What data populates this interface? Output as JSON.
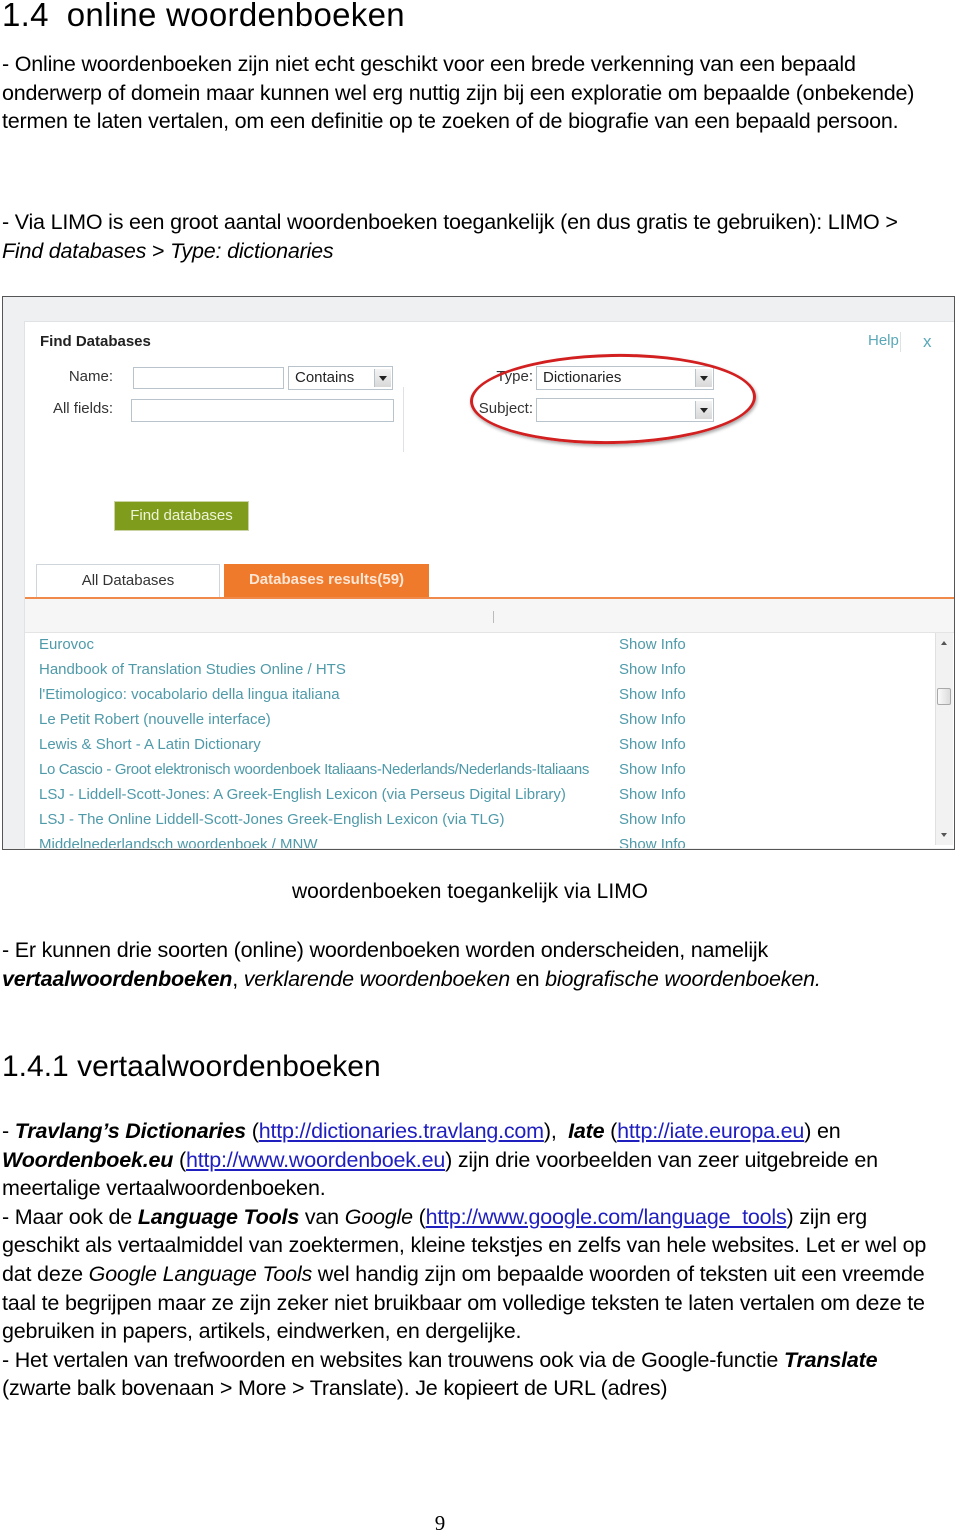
{
  "heading": {
    "number": "1.4",
    "title": "online woordenboeken"
  },
  "intro": {
    "p1": "- Online woordenboeken zijn niet echt geschikt voor een brede verkenning van een bepaald onderwerp of domein maar kunnen wel erg nuttig zijn bij een exploratie om bepaalde (onbekende) termen te laten vertalen, om een definitie op te zoeken of de biografie van een bepaald persoon.",
    "p2_lead": "- Via LIMO is een groot aantal woordenboeken toegankelijk (en dus gratis te gebruiken): LIMO > ",
    "p2_path1": "Find databases",
    "p2_sep": " > ",
    "p2_path2": "Type: dictionaries"
  },
  "screenshot": {
    "title": "Find Databases",
    "name_label": "Name:",
    "name_value": "",
    "name_match": "Contains",
    "allfields_label": "All fields:",
    "allfields_value": "",
    "type_label": "Type:",
    "type_value": "Dictionaries",
    "subject_label": "Subject:",
    "subject_value": "",
    "help": "Help",
    "close": "x",
    "find_button": "Find databases",
    "tabs": [
      {
        "label": "All Databases",
        "active": false
      },
      {
        "label": "Databases results(59)",
        "active": true
      }
    ],
    "results": [
      {
        "name": "Eurovoc",
        "action": "Show Info"
      },
      {
        "name": "Handbook of Translation Studies Online / HTS",
        "action": "Show Info"
      },
      {
        "name": "l'Etimologico: vocabolario della lingua italiana",
        "action": "Show Info"
      },
      {
        "name": "Le Petit Robert (nouvelle interface)",
        "action": "Show Info"
      },
      {
        "name": "Lewis & Short - A Latin Dictionary",
        "action": "Show Info"
      },
      {
        "name": "Lo Cascio - Groot elektronisch woordenboek Italiaans-Nederlands/Nederlands-Italiaans",
        "action": "Show Info"
      },
      {
        "name": "LSJ - Liddell-Scott-Jones: A Greek-English Lexicon (via Perseus Digital Library)",
        "action": "Show Info"
      },
      {
        "name": "LSJ - The Online Liddell-Scott-Jones Greek-English Lexicon (via TLG)",
        "action": "Show Info"
      },
      {
        "name": "Middelnederlandsch woordenboek / MNW",
        "action": "Show Info"
      }
    ],
    "colors": {
      "accent_orange": "#ef7a2c",
      "button_green": "#7f9c1c",
      "link_teal": "#4f9aa9",
      "highlight_red": "#d21f1f"
    }
  },
  "caption": "woordenboeken toegankelijk via LIMO",
  "types": {
    "lead": "- Er kunnen drie soorten (online) woordenboeken worden onderscheiden, namelijk ",
    "t1": "vertaalwoordenboeken",
    "sep1": ", ",
    "t2": "verklarende woordenboeken",
    "sep2": " en ",
    "t3": "biografische woordenboeken."
  },
  "section": {
    "number": "1.4.1",
    "title": "vertaalwoordenboeken"
  },
  "body": {
    "b1_dash": "- ",
    "travlang": "Travlang’s Dictionaries",
    "travlang_url": "http://dictionaries.travlang.com",
    "iate": "Iate",
    "iate_url": "http://iate.europa.eu",
    "en": " en ",
    "woordenboek": "Woordenboek.eu",
    "woordenboek_url": "http://www.woordenboek.eu",
    "b1_tail": " zijn drie voorbeelden van zeer uitgebreide en meertalige vertaalwoordenboeken.",
    "b2_lead": "- Maar ook de ",
    "langtools": "Language Tools",
    "van": " van ",
    "google": "Google",
    "google_url": "http://www.google.com/language_tools",
    "b2_mid": " zijn erg geschikt als vertaalmiddel van zoektermen, kleine tekstjes en zelfs van hele websites. Let er wel op dat deze ",
    "glt": "Google Language Tools",
    "b2_tail": " wel handig zijn om bepaalde woorden of teksten uit een vreemde taal te begrijpen maar ze zijn zeker niet bruikbaar om volledige teksten te laten vertalen om deze te gebruiken in papers, artikels, eindwerken, en dergelijke.",
    "b3_lead": "- Het vertalen van trefwoorden en websites kan trouwens ook via de Google-functie ",
    "translate": "Translate",
    "b3_tail": " (zwarte balk bovenaan > More > Translate). Je kopieert de URL (adres)"
  },
  "page_number": "9"
}
